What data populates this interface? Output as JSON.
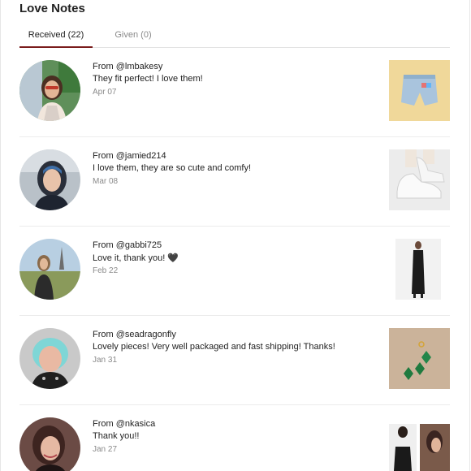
{
  "page": {
    "title": "Love Notes"
  },
  "tabs": {
    "received": "Received (22)",
    "given": "Given (0)"
  },
  "notes": [
    {
      "from": "From @lmbakesy",
      "message": "They fit perfect! I love them!",
      "date": "Apr 07"
    },
    {
      "from": "From @jamied214",
      "message": "I love them, they are so cute and comfy!",
      "date": "Mar 08"
    },
    {
      "from": "From @gabbi725",
      "message": "Love it, thank you! 🖤",
      "date": "Feb 22"
    },
    {
      "from": "From @seadragonfly",
      "message": "Lovely pieces! Very well packaged and fast shipping! Thanks!",
      "date": "Jan 31"
    },
    {
      "from": "From @nkasica",
      "message": "Thank you!!",
      "date": "Jan 27"
    }
  ]
}
